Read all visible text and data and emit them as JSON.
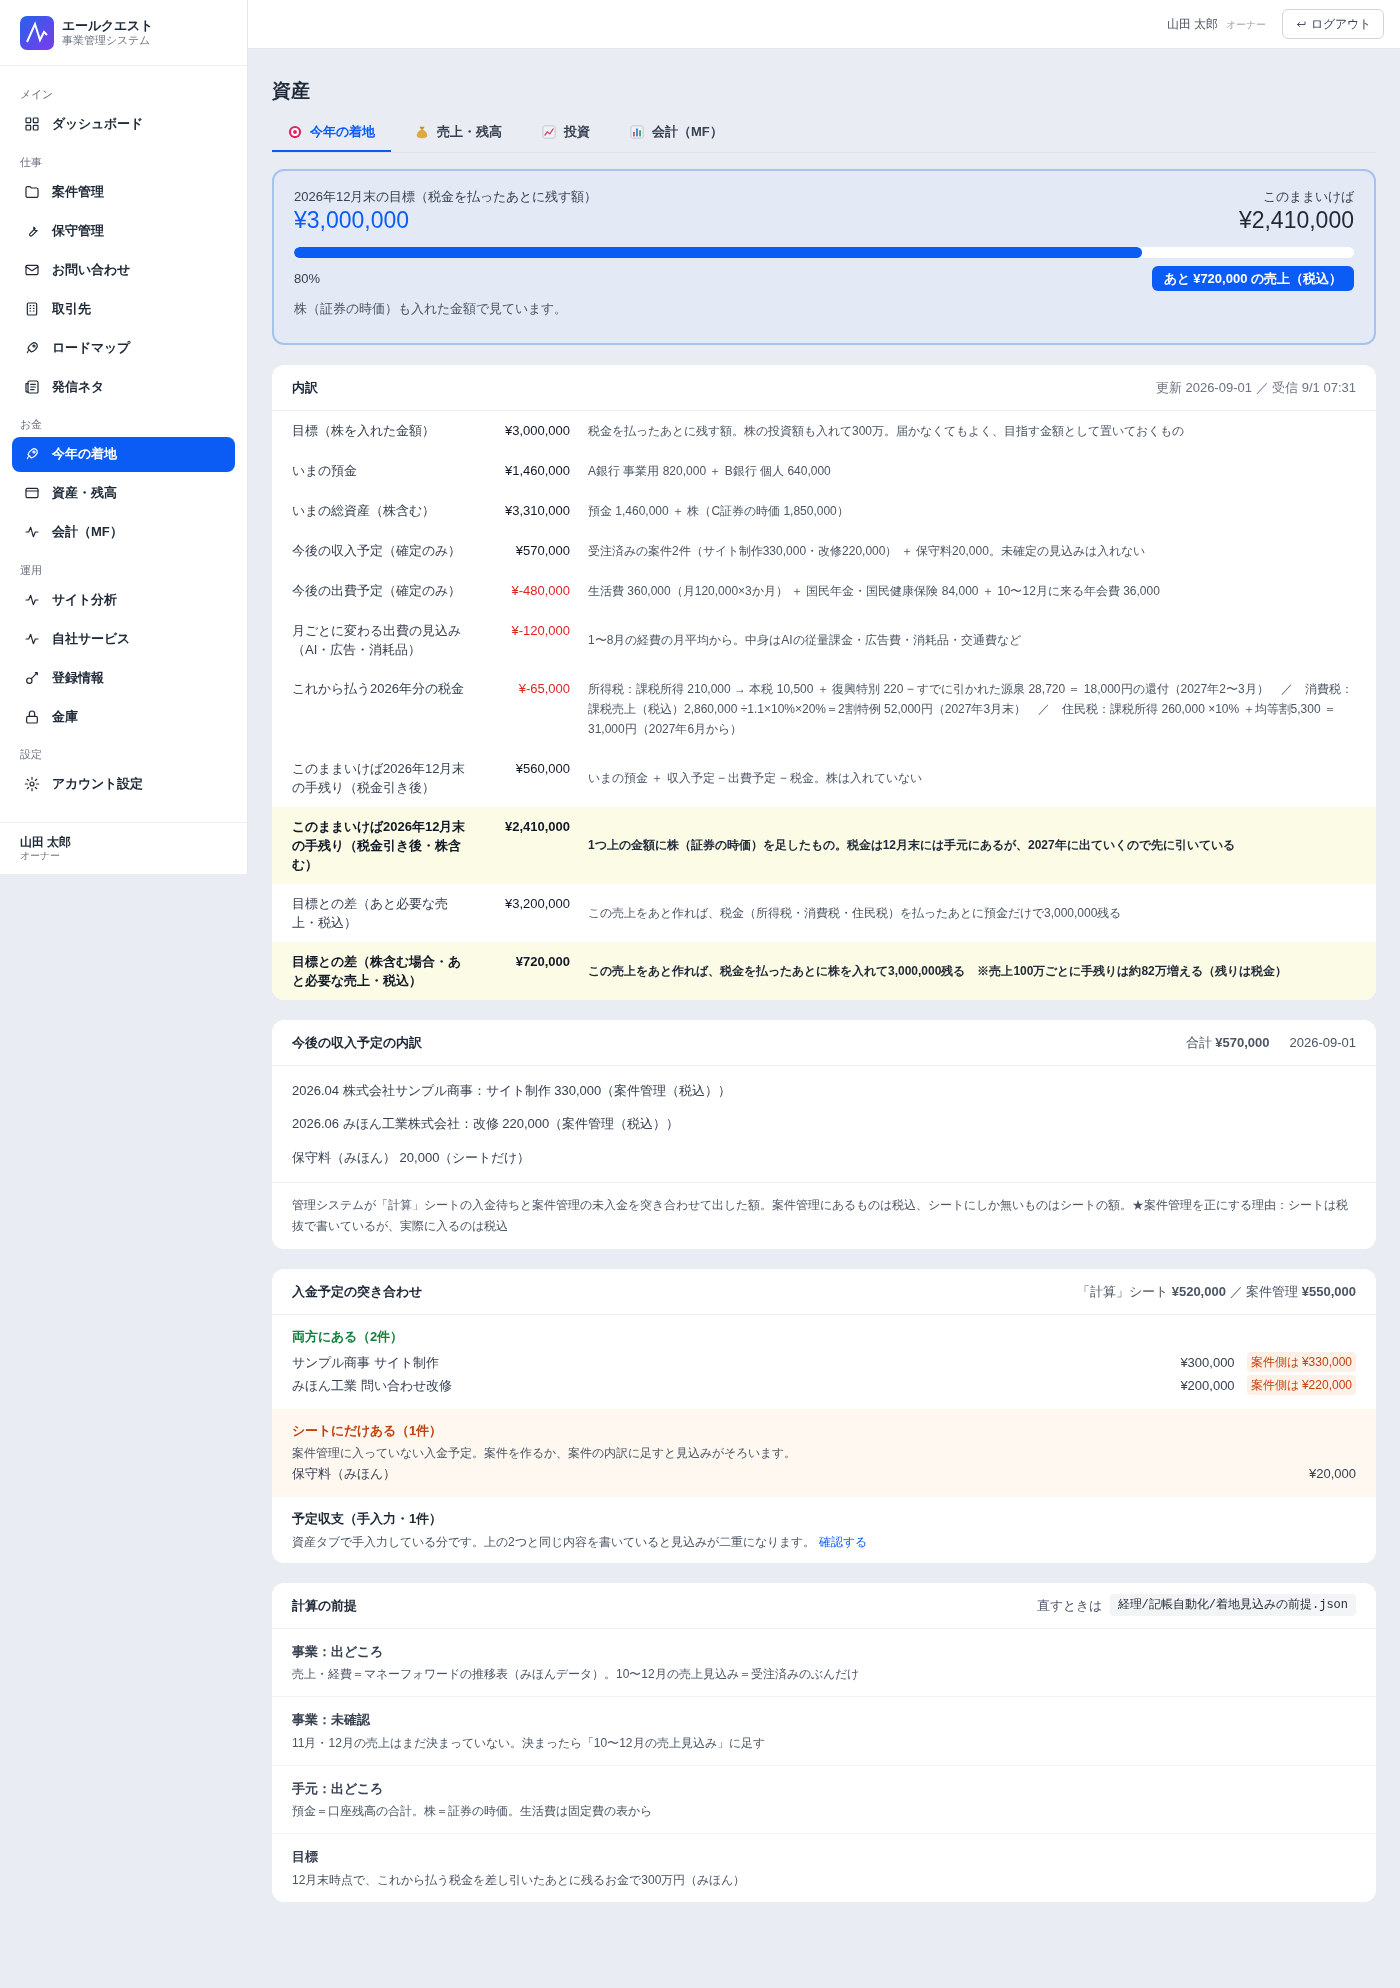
{
  "app": {
    "name": "エールクエスト",
    "subtitle": "事業管理システム"
  },
  "sidebar": {
    "groups": [
      {
        "label": "メイン",
        "items": [
          {
            "label": "ダッシュボード",
            "selected": false
          }
        ]
      },
      {
        "label": "仕事",
        "items": [
          {
            "label": "案件管理",
            "selected": false
          },
          {
            "label": "保守管理",
            "selected": false
          },
          {
            "label": "お問い合わせ",
            "selected": false
          },
          {
            "label": "取引先",
            "selected": false
          },
          {
            "label": "ロードマップ",
            "selected": false
          },
          {
            "label": "発信ネタ",
            "selected": false
          }
        ]
      },
      {
        "label": "お金",
        "items": [
          {
            "label": "今年の着地",
            "selected": true
          },
          {
            "label": "資産・残高",
            "selected": false
          },
          {
            "label": "会計（MF）",
            "selected": false
          }
        ]
      },
      {
        "label": "運用",
        "items": [
          {
            "label": "サイト分析",
            "selected": false
          },
          {
            "label": "自社サービス",
            "selected": false
          },
          {
            "label": "登録情報",
            "selected": false
          },
          {
            "label": "金庫",
            "selected": false
          }
        ]
      },
      {
        "label": "設定",
        "items": [
          {
            "label": "アカウント設定",
            "selected": false
          }
        ]
      }
    ],
    "user": {
      "name": "山田 太郎",
      "role": "オーナー"
    }
  },
  "header": {
    "user_name": "山田 太郎",
    "user_role": "オーナー",
    "logout": "ログアウト"
  },
  "page_title": "資産",
  "tabs": [
    {
      "label": "今年の着地",
      "selected": true
    },
    {
      "label": "売上・残高",
      "selected": false
    },
    {
      "label": "投資",
      "selected": false
    },
    {
      "label": "会計（MF）",
      "selected": false
    }
  ],
  "goal": {
    "label": "2026年12月末の目標（税金を払ったあとに残す額）",
    "target": "¥3,000,000",
    "forecast_label": "このままいけば",
    "forecast": "¥2,410,000",
    "level": 0.8,
    "percent": "80%",
    "remaining": "あと ¥720,000 の売上（税込）",
    "note": "株（証券の時価）も入れた金額で見ています。"
  },
  "breakdown": {
    "title": "内訳",
    "updated": "更新 2026-09-01 ／ 受信 9/1 07:31",
    "rows": [
      {
        "label": "目標（株を入れた金額）",
        "amount": "¥3,000,000",
        "negative": false,
        "highlighted": false,
        "note": "税金を払ったあとに残す額。株の投資額も入れて300万。届かなくてもよく、目指す金額として置いておくもの"
      },
      {
        "label": "いまの預金",
        "amount": "¥1,460,000",
        "negative": false,
        "highlighted": false,
        "note": "A銀行 事業用 820,000 ＋ B銀行 個人 640,000"
      },
      {
        "label": "いまの総資産（株含む）",
        "amount": "¥3,310,000",
        "negative": false,
        "highlighted": false,
        "note": "預金 1,460,000 ＋ 株（C証券の時価 1,850,000）"
      },
      {
        "label": "今後の収入予定（確定のみ）",
        "amount": "¥570,000",
        "negative": false,
        "highlighted": false,
        "note": "受注済みの案件2件（サイト制作330,000・改修220,000） ＋ 保守料20,000。未確定の見込みは入れない"
      },
      {
        "label": "今後の出費予定（確定のみ）",
        "amount": "¥-480,000",
        "negative": true,
        "highlighted": false,
        "note": "生活費 360,000（月120,000×3か月） ＋ 国民年金・国民健康保険 84,000 ＋ 10〜12月に来る年会費 36,000"
      },
      {
        "label": "月ごとに変わる出費の見込み（AI・広告・消耗品）",
        "amount": "¥-120,000",
        "negative": true,
        "highlighted": false,
        "note": "1〜8月の経費の月平均から。中身はAIの従量課金・広告費・消耗品・交通費など"
      },
      {
        "label": "これから払う2026年分の税金",
        "amount": "¥-65,000",
        "negative": true,
        "highlighted": false,
        "note": "所得税：課税所得 210,000 → 本税 10,500 ＋ 復興特別 220 − すでに引かれた源泉 28,720 ＝ 18,000円の還付（2027年2〜3月）　／　消費税：課税売上（税込）2,860,000 ÷1.1×10%×20%＝2割特例 52,000円（2027年3月末）　／　住民税：課税所得 260,000 ×10% ＋均等割5,300 ＝ 31,000円（2027年6月から）"
      },
      {
        "label": "このままいけば2026年12月末の手残り（税金引き後）",
        "amount": "¥560,000",
        "negative": false,
        "highlighted": false,
        "note": "いまの預金 ＋ 収入予定 − 出費予定 − 税金。株は入れていない"
      },
      {
        "label": "このままいけば2026年12月末の手残り（税金引き後・株含む）",
        "amount": "¥2,410,000",
        "negative": false,
        "highlighted": true,
        "note": "1つ上の金額に株（証券の時価）を足したもの。税金は12月末には手元にあるが、2027年に出ていくので先に引いている"
      },
      {
        "label": "目標との差（あと必要な売上・税込）",
        "amount": "¥3,200,000",
        "negative": false,
        "highlighted": false,
        "note": "この売上をあと作れば、税金（所得税・消費税・住民税）を払ったあとに預金だけで3,000,000残る"
      },
      {
        "label": "目標との差（株含む場合・あと必要な売上・税込）",
        "amount": "¥720,000",
        "negative": false,
        "highlighted": true,
        "note": "この売上をあと作れば、税金を払ったあとに株を入れて3,000,000残る　※売上100万ごとに手残りは約82万増える（残りは税金）"
      }
    ]
  },
  "income": {
    "title": "今後の収入予定の内訳",
    "total": "合計 **¥570,000**",
    "date": "2026-09-01",
    "items": [
      "2026.04 株式会社サンプル商事：サイト制作 330,000（案件管理（税込））",
      "2026.06 みほん工業株式会社：改修 220,000（案件管理（税込））",
      "保守料（みほん） 20,000（シートだけ）"
    ],
    "note": "管理システムが「計算」シートの入金待ちと案件管理の未入金を突き合わせて出した額。案件管理にあるものは税込、シートにしか無いものはシートの額。★案件管理を正にする理由：シートは税抜で書いているが、実際に入るのは税込"
  },
  "reconciliation": {
    "title": "入金予定の突き合わせ",
    "summary": "「計算」シート **¥520,000** ／ 案件管理 **¥550,000**",
    "groups": [
      {
        "kind": "both",
        "title": "両方にある（2件）",
        "rows": [
          {
            "label": "サンプル商事 サイト制作",
            "amount": "¥300,000",
            "badge": "案件側は ¥330,000"
          },
          {
            "label": "みほん工業 問い合わせ改修",
            "amount": "¥200,000",
            "badge": "案件側は ¥220,000"
          }
        ]
      },
      {
        "kind": "sheet_only",
        "title": "シートにだけある（1件）",
        "description": "案件管理に入っていない入金予定。案件を作るか、案件の内訳に足すと見込みがそろいます。",
        "rows": [
          {
            "label": "保守料（みほん）",
            "amount": "¥20,000"
          }
        ]
      },
      {
        "kind": "manual",
        "title": "予定収支（手入力・1件）",
        "description": "資産タブで手入力している分です。上の2つと同じ内容を書いていると見込みが二重になります。",
        "link": "確認する"
      }
    ]
  },
  "assumptions": {
    "title": "計算の前提",
    "edit_label": "直すときは",
    "path": "経理/記帳自動化/着地見込みの前提.json",
    "items": [
      {
        "title": "事業：出どころ",
        "text": "売上・経費＝マネーフォワードの推移表（みほんデータ）。10〜12月の売上見込み＝受注済みのぶんだけ"
      },
      {
        "title": "事業：未確認",
        "text": "11月・12月の売上はまだ決まっていない。決まったら「10〜12月の売上見込み」に足す"
      },
      {
        "title": "手元：出どころ",
        "text": "預金＝口座残高の合計。株＝証券の時価。生活費は固定費の表から"
      },
      {
        "title": "目標",
        "text": "12月末時点で、これから払う税金を差し引いたあとに残るお金で300万円（みほん）"
      }
    ]
  }
}
